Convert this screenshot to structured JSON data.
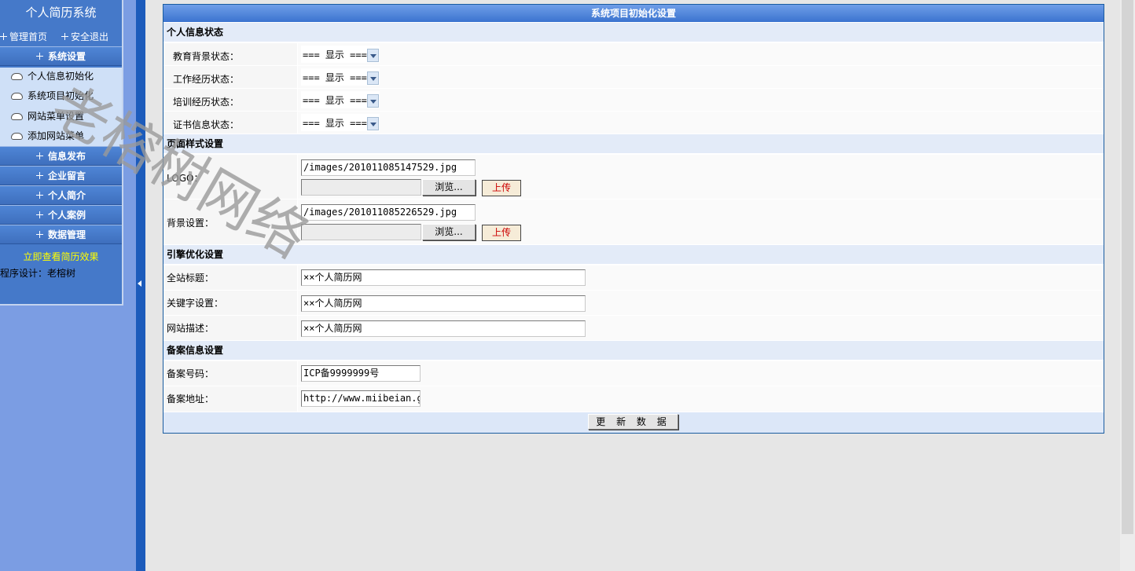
{
  "sidebar": {
    "title": "个人简历系统",
    "home_link": "管理首页",
    "logout_link": "安全退出",
    "menu": [
      {
        "label": "系统设置",
        "sub_items": [
          "个人信息初始化",
          "系统项目初始化",
          "网站菜单设置",
          "添加网站菜单"
        ]
      },
      {
        "label": "信息发布"
      },
      {
        "label": "企业留言"
      },
      {
        "label": "个人简介"
      },
      {
        "label": "个人案例"
      },
      {
        "label": "数据管理"
      }
    ],
    "preview_link": "立即查看简历效果",
    "credit": "程序设计：老榕树"
  },
  "watermark": "老榕树网络",
  "panel": {
    "title": "系统项目初始化设置",
    "sections": {
      "personal": "个人信息状态",
      "style": "页面样式设置",
      "seo": "引擎优化设置",
      "icp": "备案信息设置"
    },
    "status_rows": [
      {
        "label": "教育背景状态：",
        "value": "=== 显示 ==="
      },
      {
        "label": "工作经历状态：",
        "value": "=== 显示 ==="
      },
      {
        "label": "培训经历状态：",
        "value": "=== 显示 ==="
      },
      {
        "label": "证书信息状态：",
        "value": "=== 显示 ==="
      }
    ],
    "logo": {
      "label": "LOGO：",
      "path": "/images/201011085147529.jpg"
    },
    "background": {
      "label": "背景设置：",
      "path": "/images/201011085226529.jpg"
    },
    "browse_label": "浏览...",
    "upload_label": "上传",
    "seo_rows": [
      {
        "label": "全站标题：",
        "value": "××个人简历网"
      },
      {
        "label": "关键字设置：",
        "value": "××个人简历网"
      },
      {
        "label": "网站描述：",
        "value": "××个人简历网"
      }
    ],
    "icp_number": {
      "label": "备案号码：",
      "value": "ICP备9999999号"
    },
    "icp_url": {
      "label": "备案地址：",
      "value": "http://www.miibeian.g"
    },
    "submit_label": "更 新 数 据"
  },
  "colors": {
    "sidebar_bg": "#4579c9",
    "page_bg": "#7b9de3",
    "toggle_bar": "#1c5bbb",
    "panel_header": "#3b73cf",
    "section_bg": "#e3ebf8",
    "preview_link": "#ffff00",
    "upload_text": "#cc0000"
  }
}
